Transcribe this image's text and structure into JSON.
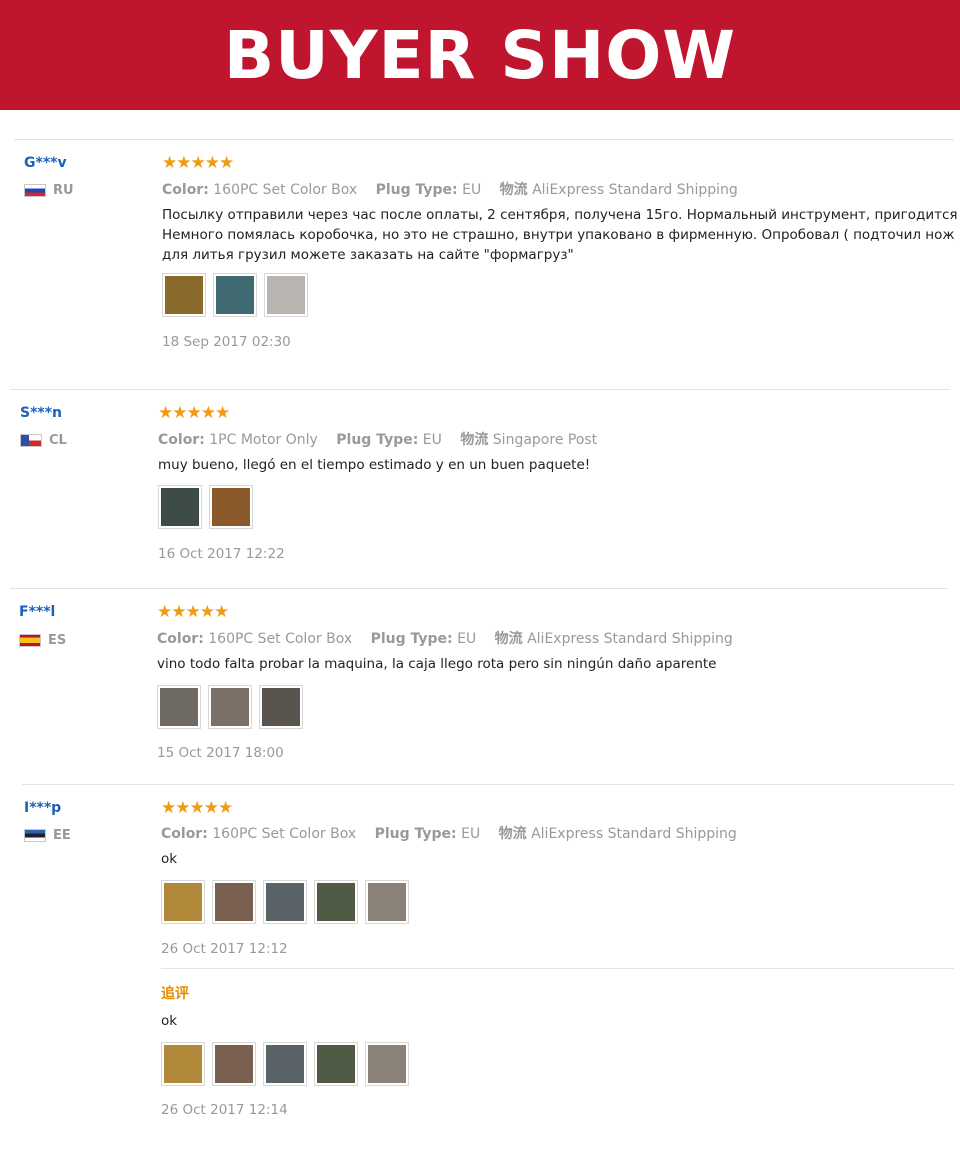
{
  "banner": {
    "title": "BUYER SHOW"
  },
  "labels": {
    "color": "Color:",
    "plug": "Plug Type:",
    "ship": "物流",
    "followup": "追评"
  },
  "reviews": [
    {
      "user": "G***v",
      "country": "RU",
      "stars": "★★★★★",
      "color": "160PC Set Color Box",
      "plug": "EU",
      "ship": "AliExpress Standard Shipping",
      "lines": [
        "Посылку отправили через час после оплаты, 2 сентября, получена 15го. Нормальный инструмент, пригодится )))",
        "Немного помялась коробочка, но это не страшно, внутри упаковано в фирменную. Опробовал ( подточил нож ) . ф",
        "для литья грузил можете заказать на сайте \"формагруз\""
      ],
      "date": "18 Sep 2017 02:30",
      "thumbs": [
        "#8a6a2a",
        "#3f6a72",
        "#b8b4b0"
      ]
    },
    {
      "user": "S***n",
      "country": "CL",
      "stars": "★★★★★",
      "color": "1PC Motor Only",
      "plug": "EU",
      "ship": "Singapore Post",
      "lines": [
        "muy bueno, llegó en el tiempo estimado y en un buen paquete!"
      ],
      "date": "16 Oct 2017 12:22",
      "thumbs": [
        "#3c4a48",
        "#8a5a2a"
      ]
    },
    {
      "user": "F***l",
      "country": "ES",
      "stars": "★★★★★",
      "color": "160PC Set Color Box",
      "plug": "EU",
      "ship": "AliExpress Standard Shipping",
      "lines": [
        "vino todo falta probar la maquina, la caja llego rota pero sin ningún daño aparente"
      ],
      "date": "15 Oct 2017 18:00",
      "thumbs": [
        "#6e6a62",
        "#7a7068",
        "#5a544e"
      ]
    },
    {
      "user": "I***p",
      "country": "EE",
      "stars": "★★★★★",
      "color": "160PC Set Color Box",
      "plug": "EU",
      "ship": "AliExpress Standard Shipping",
      "lines": [
        "ok"
      ],
      "date": "26 Oct 2017 12:12",
      "thumbs": [
        "#b08a3a",
        "#7a6050",
        "#5a6468",
        "#4e5a44",
        "#8a8278"
      ],
      "followup_text": "ok",
      "followup_date": "26 Oct 2017 12:14",
      "followup_thumbs": [
        "#b08a3a",
        "#7a6050",
        "#5a6468",
        "#4e5a44",
        "#8a8278"
      ]
    }
  ]
}
